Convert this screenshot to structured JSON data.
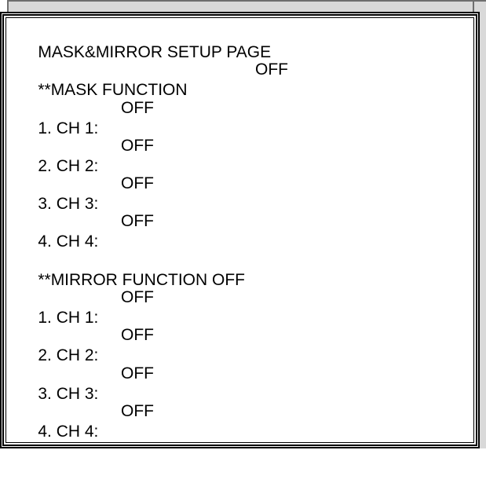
{
  "title": "MASK&MIRROR SETUP PAGE",
  "mask": {
    "label": "**MASK FUNCTION",
    "value": "OFF",
    "channels": [
      {
        "label": "1. CH 1:",
        "value": "OFF"
      },
      {
        "label": "2. CH 2:",
        "value": "OFF"
      },
      {
        "label": "3. CH 3:",
        "value": "OFF"
      },
      {
        "label": "4. CH 4:",
        "value": "OFF"
      }
    ]
  },
  "mirror": {
    "label": "**MIRROR FUNCTION OFF",
    "channels": [
      {
        "label": "1. CH 1:",
        "value": "OFF"
      },
      {
        "label": "2. CH 2:",
        "value": "OFF"
      },
      {
        "label": "3. CH 3:",
        "value": "OFF"
      },
      {
        "label": "4. CH 4:",
        "value": "OFF"
      }
    ]
  }
}
